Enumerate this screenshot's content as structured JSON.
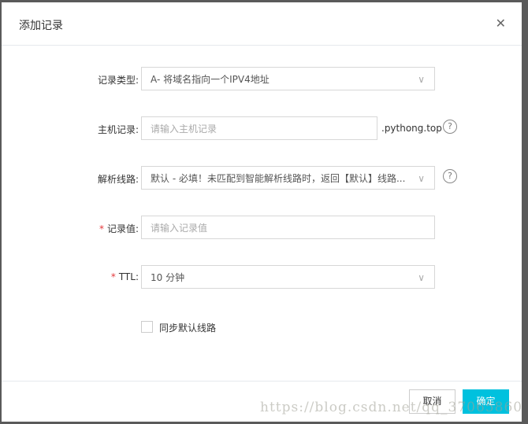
{
  "dialog": {
    "title": "添加记录",
    "close_icon": "close-icon"
  },
  "form": {
    "record_type": {
      "label": "记录类型:",
      "value": "A- 将域名指向一个IPV4地址"
    },
    "host": {
      "label": "主机记录:",
      "placeholder": "请输入主机记录",
      "suffix": ".pythong.top"
    },
    "line": {
      "label": "解析线路:",
      "value": "默认 - 必填！未匹配到智能解析线路时，返回【默认】线路..."
    },
    "value": {
      "label": "记录值:",
      "placeholder": "请输入记录值",
      "required": "*"
    },
    "ttl": {
      "label": "TTL:",
      "value": "10 分钟",
      "required": "*"
    },
    "sync": {
      "label": "同步默认线路",
      "checked": false
    }
  },
  "help_glyph": "?",
  "chevron": "∨",
  "footer": {
    "cancel": "取消",
    "confirm": "确定"
  },
  "watermark": "https://blog.csdn.net/qq_37065860",
  "colors": {
    "primary": "#00c1de",
    "required": "#e4393c"
  }
}
